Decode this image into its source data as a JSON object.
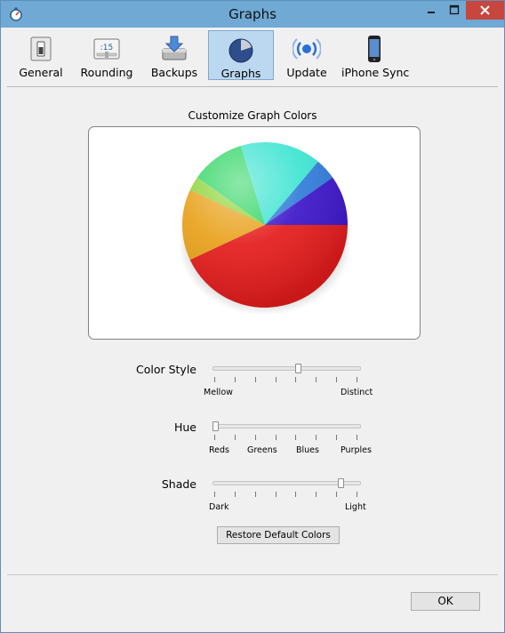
{
  "window": {
    "title": "Graphs"
  },
  "toolbar": {
    "items": [
      {
        "label": "General",
        "icon": "toggle-switch-icon",
        "active": false
      },
      {
        "label": "Rounding",
        "icon": "clock-time-icon",
        "active": false
      },
      {
        "label": "Backups",
        "icon": "hard-drive-download-icon",
        "active": false
      },
      {
        "label": "Graphs",
        "icon": "pie-globe-icon",
        "active": true
      },
      {
        "label": "Update",
        "icon": "update-waves-icon",
        "active": false
      },
      {
        "label": "iPhone Sync",
        "icon": "iphone-icon",
        "active": false
      }
    ]
  },
  "main": {
    "section_title": "Customize Graph Colors",
    "pie_colors": [
      "#e41b1b",
      "#e8a11a",
      "#8fd43a",
      "#2fd563",
      "#3de4d2",
      "#2f7bd9",
      "#3c15c9"
    ],
    "sliders": [
      {
        "label": "Color Style",
        "value": 0.58,
        "ticks": 8,
        "tick_labels": [
          "Mellow",
          "Distinct"
        ]
      },
      {
        "label": "Hue",
        "value": 0.0,
        "ticks": 8,
        "tick_labels": [
          "Reds",
          "Greens",
          "Blues",
          "Purples"
        ]
      },
      {
        "label": "Shade",
        "value": 0.88,
        "ticks": 8,
        "tick_labels": [
          "Dark",
          "Light"
        ]
      }
    ],
    "restore_label": "Restore Default Colors"
  },
  "footer": {
    "ok_label": "OK"
  },
  "colors": {
    "titlebar": "#6fa9d4",
    "close": "#c7463d",
    "active_tab": "#bcd8f0"
  }
}
